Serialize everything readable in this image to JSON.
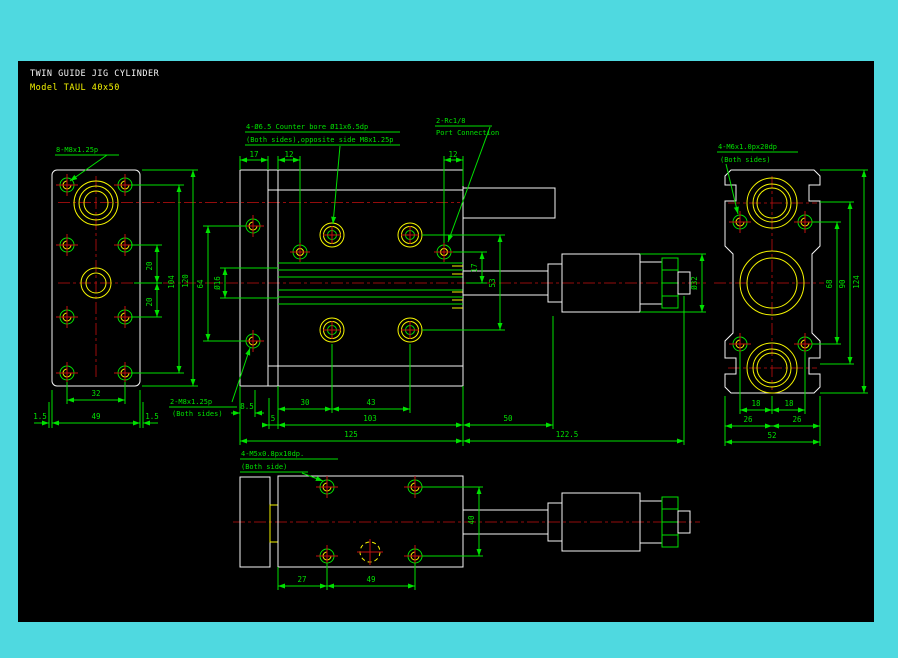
{
  "colors": {
    "frame": "#4fd9e0",
    "canvas": "#000000",
    "outline": "#f5f5f5",
    "dimension": "#00e100",
    "detail": "#f5f500",
    "centerline": "#c31010"
  },
  "title_block": {
    "line1": "TWIN GUIDE JIG CYLINDER",
    "line2": "Model TAUL 40x50"
  },
  "left_view": {
    "thread_label": "8-M8x1.25p",
    "dims": {
      "d20a": "20",
      "d20b": "20",
      "d104": "104",
      "d120": "120",
      "d32": "32",
      "d49": "49",
      "d1_5l": "1.5",
      "d1_5r": "1.5"
    }
  },
  "front_view": {
    "counterbore_note1": "4-Ø6.5 Counter bore Ø11x6.5dp",
    "counterbore_note2": "(Both sides),opposite side M8x1.25p",
    "port_note1": "2-Rc1/8",
    "port_note2": "Port Connection",
    "side_thread_note1": "2-M8x1.25p",
    "side_thread_note2": "(Both sides)",
    "dims": {
      "d17_top": "17",
      "d12_left": "12",
      "d12_right": "12",
      "d8_5": "8.5",
      "d5": "5",
      "d30": "30",
      "d43": "43",
      "d103": "103",
      "d125": "125",
      "d50": "50",
      "d122_5": "122.5",
      "d17_right": "17",
      "d53": "53",
      "d64": "64",
      "dia16": "Ø16",
      "dia32": "Ø32"
    }
  },
  "end_view": {
    "thread_note1": "4-M6x1.0px20dp",
    "thread_note2": "(Both sides)",
    "dims": {
      "d68": "68",
      "d90": "90",
      "d124": "124",
      "d18a": "18",
      "d18b": "18",
      "d26a": "26",
      "d26b": "26",
      "d52": "52"
    }
  },
  "bottom_view": {
    "thread_note1": "4-M5x0.8px10dp.",
    "thread_note2": "(Both side)",
    "dims": {
      "d27": "27",
      "d49": "49",
      "d40": "40"
    }
  }
}
